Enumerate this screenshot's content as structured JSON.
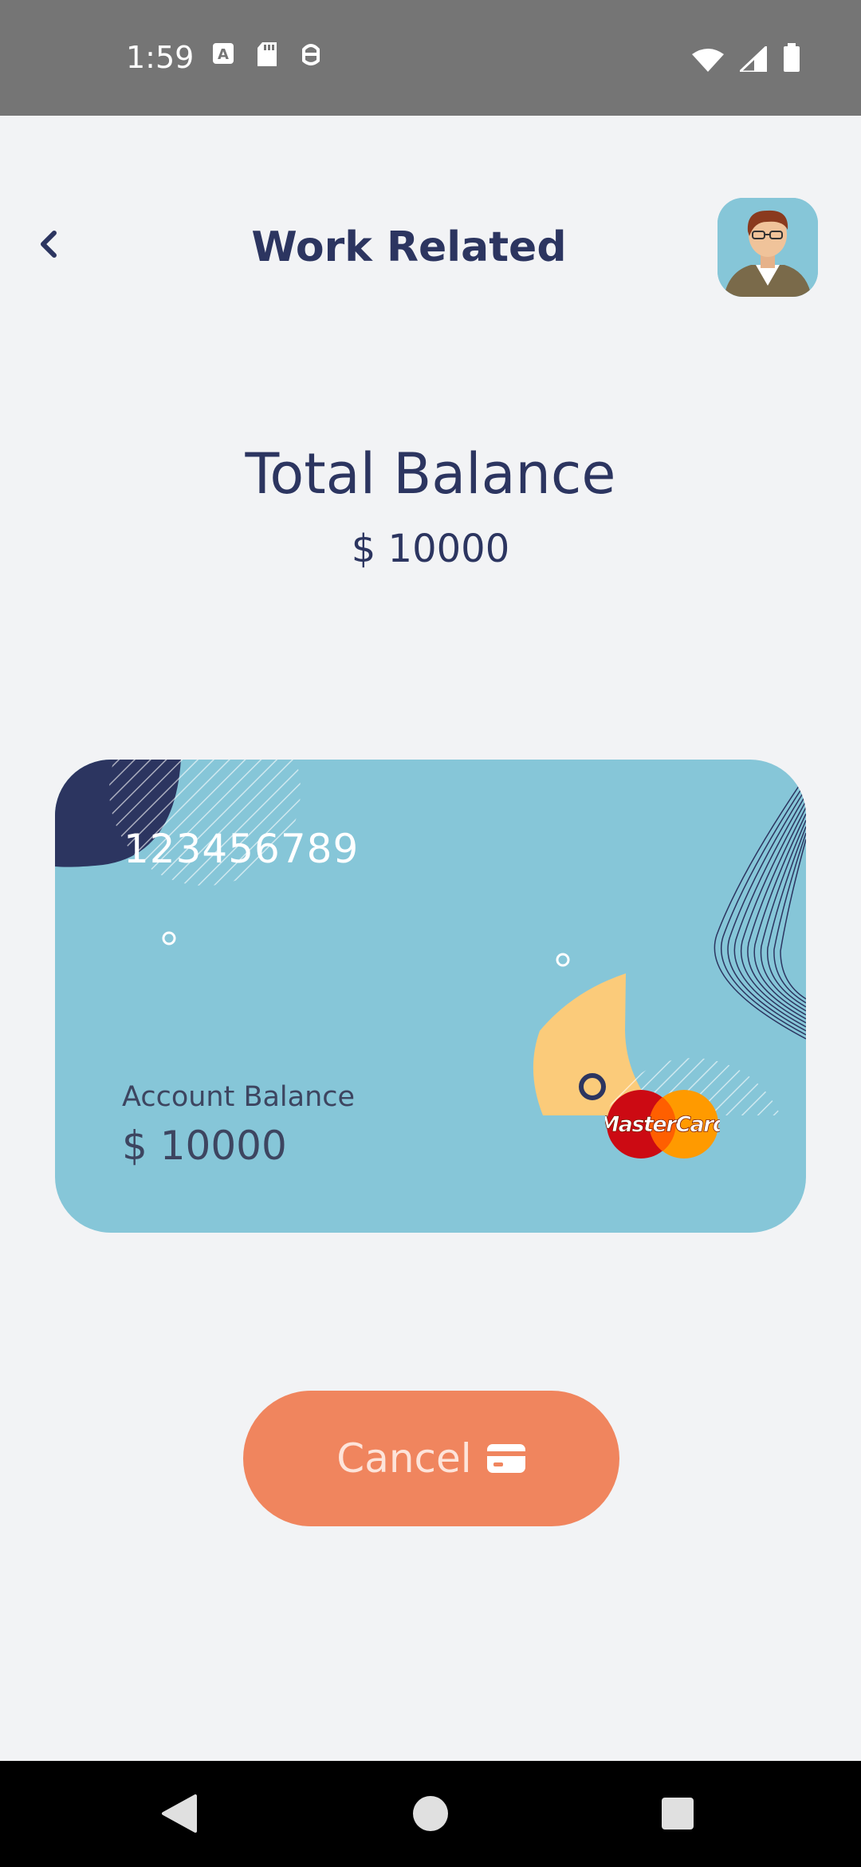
{
  "status_bar": {
    "time": "1:59",
    "left_icons": [
      "text-notification-icon",
      "sd-card-icon",
      "android-debug-icon"
    ],
    "right_icons": [
      "wifi-icon",
      "signal-icon",
      "battery-icon"
    ]
  },
  "header": {
    "title": "Work Related",
    "back_icon": "chevron-left-icon",
    "avatar": "user-avatar"
  },
  "balance": {
    "label": "Total Balance",
    "value": "$ 10000"
  },
  "card": {
    "number": "123456789",
    "account_label": "Account Balance",
    "account_value": "$ 10000",
    "brand": "MasterCard",
    "colors": {
      "background": "#86c6d8",
      "dark": "#2c3560",
      "accent": "#fbcb7a"
    }
  },
  "actions": {
    "cancel_label": "Cancel",
    "cancel_icon": "credit-card-icon",
    "button_color": "#f0855e"
  },
  "nav": [
    "back-nav",
    "home-nav",
    "recents-nav"
  ]
}
